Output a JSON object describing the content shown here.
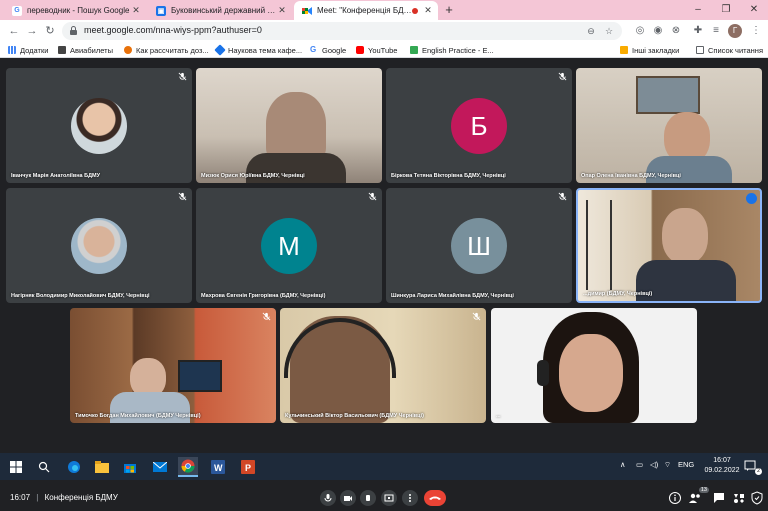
{
  "browser": {
    "tabs": [
      {
        "label": "переводник - Пошук Google",
        "icon": "google-g-icon"
      },
      {
        "label": "Буковинський державний меди",
        "icon": "page-icon"
      },
      {
        "label": "Meet: \"Конференція БДМУ\"",
        "icon": "meet-icon",
        "active": true
      }
    ],
    "new_tab": "+",
    "window_controls": [
      "–",
      "❐",
      "✕"
    ],
    "url": "meet.google.com/nna-wiys-ppm?authuser=0",
    "profile_initial": "Г"
  },
  "bookmarks": {
    "items": [
      "Додатки",
      "Авиабилеты",
      "Как рассчитать доз...",
      "Наукова тема кафе...",
      "Google",
      "YouTube",
      "English Practice - E..."
    ],
    "other": "Інші закладки",
    "reading_list": "Список читання"
  },
  "meet": {
    "participants": [
      {
        "name": "Іванчук Марія Анатоліївна БДМУ",
        "type": "photo-avatar"
      },
      {
        "name": "Мизюк Орися Юріївна БДМУ, Чернівці",
        "type": "video"
      },
      {
        "name": "Біркова Тетяна Вікторівна БДМУ, Чернівці",
        "type": "letter",
        "initial": "Б",
        "color": "#c2185b"
      },
      {
        "name": "Опар Олена Іванівна БДМУ, Чернівці",
        "type": "video"
      },
      {
        "name": "Нагірняк Володимир Миколайович БДМУ, Чернівці",
        "type": "photo-avatar"
      },
      {
        "name": "Махрова Євгенія Григорівна (БДМУ, Чернівці)",
        "type": "letter",
        "initial": "М",
        "color": "#00838f"
      },
      {
        "name": "Шинкура Лариса Михайлівна БДМУ, Чернівці",
        "type": "letter",
        "initial": "Ш",
        "color": "#78909c"
      },
      {
        "name": "...димир (БДМУ, Чернівці)",
        "type": "video"
      },
      {
        "name": "Тимочко Богдан Михайлович (БДМУ Чернівці)",
        "type": "video"
      },
      {
        "name": "Кульчинський Віктор Васильович (БДМУ Чернівці)",
        "type": "video"
      },
      {
        "name": "...",
        "type": "video"
      }
    ],
    "time": "16:07",
    "meeting_name": "Конференція БДМУ",
    "participant_count": "13"
  },
  "taskbar": {
    "language": "ENG",
    "time": "16:07",
    "date": "09.02.2022",
    "notification_count": "2"
  },
  "colors": {
    "tabstrip": "#f4c6d6",
    "meet_bg": "#202124",
    "tile_bg": "#3c4043",
    "hangup": "#ea4335",
    "active_speaker": "#8ab4f8"
  }
}
